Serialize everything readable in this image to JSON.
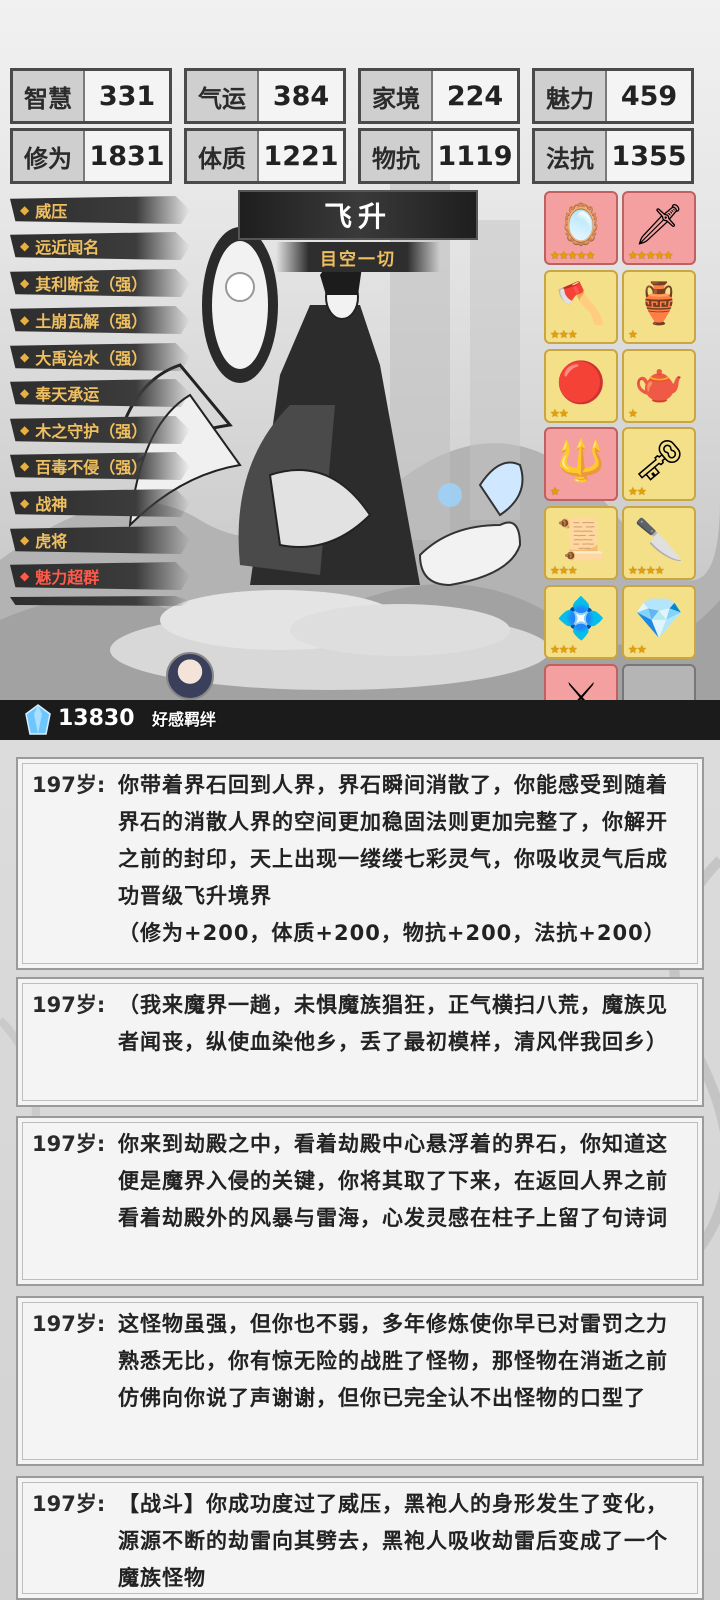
{
  "stats": [
    {
      "label": "智慧",
      "value": "331"
    },
    {
      "label": "气运",
      "value": "384"
    },
    {
      "label": "家境",
      "value": "224"
    },
    {
      "label": "魅力",
      "value": "459"
    },
    {
      "label": "修为",
      "value": "1831"
    },
    {
      "label": "体质",
      "value": "1221"
    },
    {
      "label": "物抗",
      "value": "1119"
    },
    {
      "label": "法抗",
      "value": "1355"
    }
  ],
  "traits": [
    {
      "label": "威压"
    },
    {
      "label": "远近闻名"
    },
    {
      "label": "其利断金（强）"
    },
    {
      "label": "土崩瓦解（强）"
    },
    {
      "label": "大禹治水（强）"
    },
    {
      "label": "奉天承运"
    },
    {
      "label": "木之守护（强）"
    },
    {
      "label": "百毒不侵（强）"
    },
    {
      "label": "战神"
    },
    {
      "label": "虎将"
    },
    {
      "label": "魅力超群"
    }
  ],
  "realm": {
    "title": "飞升",
    "subtitle": "目空一切"
  },
  "items": [
    {
      "icon": "mirror-icon",
      "glyph": "🪞",
      "stars": "★★★★★",
      "rarity": "pink"
    },
    {
      "icon": "sword-icon",
      "glyph": "🗡",
      "stars": "★★★★★",
      "rarity": "pink"
    },
    {
      "icon": "golden-axe-icon",
      "glyph": "🪓",
      "stars": "★★★",
      "rarity": "yellow"
    },
    {
      "icon": "incense-burner-icon",
      "glyph": "🏺",
      "stars": "★",
      "rarity": "yellow"
    },
    {
      "icon": "red-orb-icon",
      "glyph": "🔴",
      "stars": "★★",
      "rarity": "yellow"
    },
    {
      "icon": "teapot-icon",
      "glyph": "🫖",
      "stars": "★",
      "rarity": "yellow"
    },
    {
      "icon": "trident-icon",
      "glyph": "🔱",
      "stars": "★",
      "rarity": "pink"
    },
    {
      "icon": "golden-key-icon",
      "glyph": "🗝",
      "stars": "★★",
      "rarity": "yellow"
    },
    {
      "icon": "scroll-icon",
      "glyph": "📜",
      "stars": "★★★",
      "rarity": "yellow"
    },
    {
      "icon": "jade-blade-icon",
      "glyph": "🔪",
      "stars": "★★★★",
      "rarity": "yellow"
    },
    {
      "icon": "blue-talisman-icon",
      "glyph": "💠",
      "stars": "★★★",
      "rarity": "yellow"
    },
    {
      "icon": "rainbow-crystal-icon",
      "glyph": "💎",
      "stars": "★★",
      "rarity": "yellow"
    },
    {
      "icon": "halberd-icon",
      "glyph": "⚔",
      "stars": "★★",
      "rarity": "pink"
    },
    {
      "icon": "empty-slot",
      "glyph": "",
      "stars": "",
      "rarity": "empty"
    }
  ],
  "currency": {
    "value": "13830",
    "icon": "crystal-gem-icon"
  },
  "companion": {
    "label": "好感羁绊"
  },
  "log": [
    {
      "age": "197岁:",
      "text": "你带着界石回到人界，界石瞬间消散了，你能感受到随着界石的消散人界的空间更加稳固法则更加完整了，你解开之前的封印，天上出现一缕缕七彩灵气，你吸收灵气后成功晋级飞升境界",
      "extra": "（修为+200，体质+200，物抗+200，法抗+200）"
    },
    {
      "age": "197岁:",
      "text": "（我来魔界一趟，未惧魔族猖狂，正气横扫八荒，魔族见者闻丧，纵使血染他乡，丢了最初模样，清风伴我回乡）",
      "extra": ""
    },
    {
      "age": "197岁:",
      "text": "你来到劫殿之中，看着劫殿中心悬浮着的界石，你知道这便是魔界入侵的关键，你将其取了下来，在返回人界之前看着劫殿外的风暴与雷海，心发灵感在柱子上留了句诗词",
      "extra": ""
    },
    {
      "age": "197岁:",
      "text": "这怪物虽强，但你也不弱，多年修炼使你早已对雷罚之力熟悉无比，你有惊无险的战胜了怪物，那怪物在消逝之前仿佛向你说了声谢谢，但你已完全认不出怪物的口型了",
      "extra": ""
    },
    {
      "age": "197岁:",
      "text": "【战斗】你成功度过了威压，黑袍人的身形发生了变化，源源不断的劫雷向其劈去，黑袍人吸收劫雷后变成了一个魔族怪物",
      "extra": ""
    }
  ],
  "colors": {
    "trait_gold": "#f0c060",
    "trait_red": "#ff5a4a",
    "item_pink": "#f4a0a0",
    "item_yellow": "#f5e08a"
  }
}
